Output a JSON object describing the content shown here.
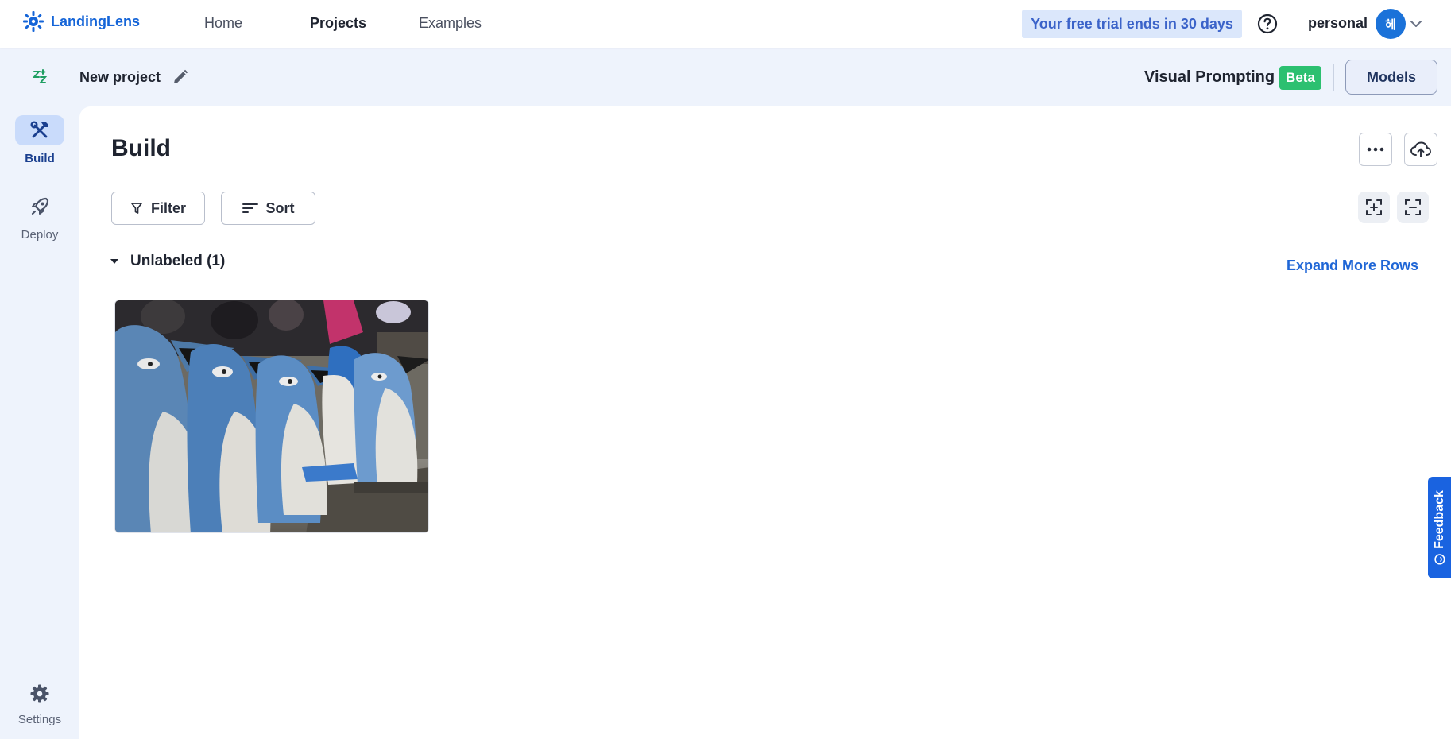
{
  "brand": {
    "name": "LandingLens",
    "color": "#1565d8"
  },
  "nav": {
    "home": "Home",
    "projects": "Projects",
    "examples": "Examples",
    "active": "Projects"
  },
  "header_right": {
    "trial_text": "Your free trial ends in 30 days",
    "help_icon": "help-circle-icon",
    "account_name": "personal",
    "avatar_initial": "헤"
  },
  "project_bar": {
    "name": "New project",
    "visual_prompting": "Visual Prompting",
    "beta_badge": "Beta",
    "models_button": "Models"
  },
  "rail": {
    "build": "Build",
    "deploy": "Deploy",
    "settings": "Settings",
    "active": "Build"
  },
  "main": {
    "title": "Build",
    "filter_button": "Filter",
    "sort_button": "Sort",
    "section": {
      "label": "Unlabeled (1)",
      "expanded": true
    },
    "expand_link": "Expand More Rows",
    "images": [
      {
        "subject": "penguin-shaped trash bins"
      }
    ]
  },
  "feedback": {
    "label": "Feedback"
  },
  "colors": {
    "accent": "#1f66d6",
    "beta": "#2cc070",
    "trial_bg": "#dbe7fb",
    "background": "#eef3fc"
  }
}
